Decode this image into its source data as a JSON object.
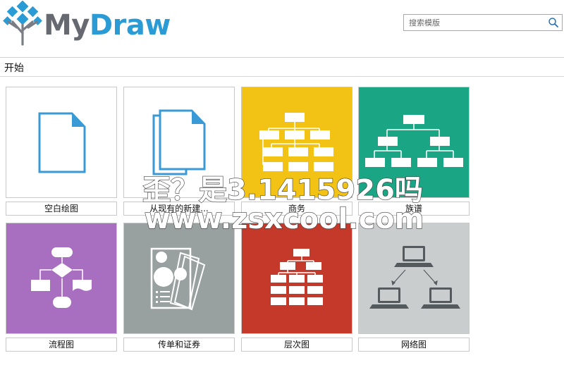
{
  "app": {
    "logo_my": "My",
    "logo_draw": "Draw"
  },
  "search": {
    "placeholder": "搜索模版"
  },
  "section": {
    "title": "开始"
  },
  "tiles": [
    {
      "label": "空白绘图",
      "bg": "#ffffff",
      "icon": "blank-document-icon"
    },
    {
      "label": "从现有的新建...",
      "bg": "#ffffff",
      "icon": "copy-documents-icon"
    },
    {
      "label": "商务",
      "bg": "#f2c314",
      "icon": "org-chart-icon"
    },
    {
      "label": "族谱",
      "bg": "#1aa585",
      "icon": "family-tree-icon"
    },
    {
      "label": "流程图",
      "bg": "#a86fc1",
      "icon": "flowchart-icon"
    },
    {
      "label": "传单和证券",
      "bg": "#98a19f",
      "icon": "flyer-icon"
    },
    {
      "label": "层次图",
      "bg": "#c5392b",
      "icon": "hierarchy-icon"
    },
    {
      "label": "网络图",
      "bg": "#c9cdcd",
      "icon": "network-icon"
    }
  ],
  "watermark": {
    "line1": "歪？是3.1415926吗",
    "line2": "www.zsxcool.com"
  },
  "colors": {
    "accent": "#2b9bd6",
    "logo_gray": "#666a70"
  }
}
